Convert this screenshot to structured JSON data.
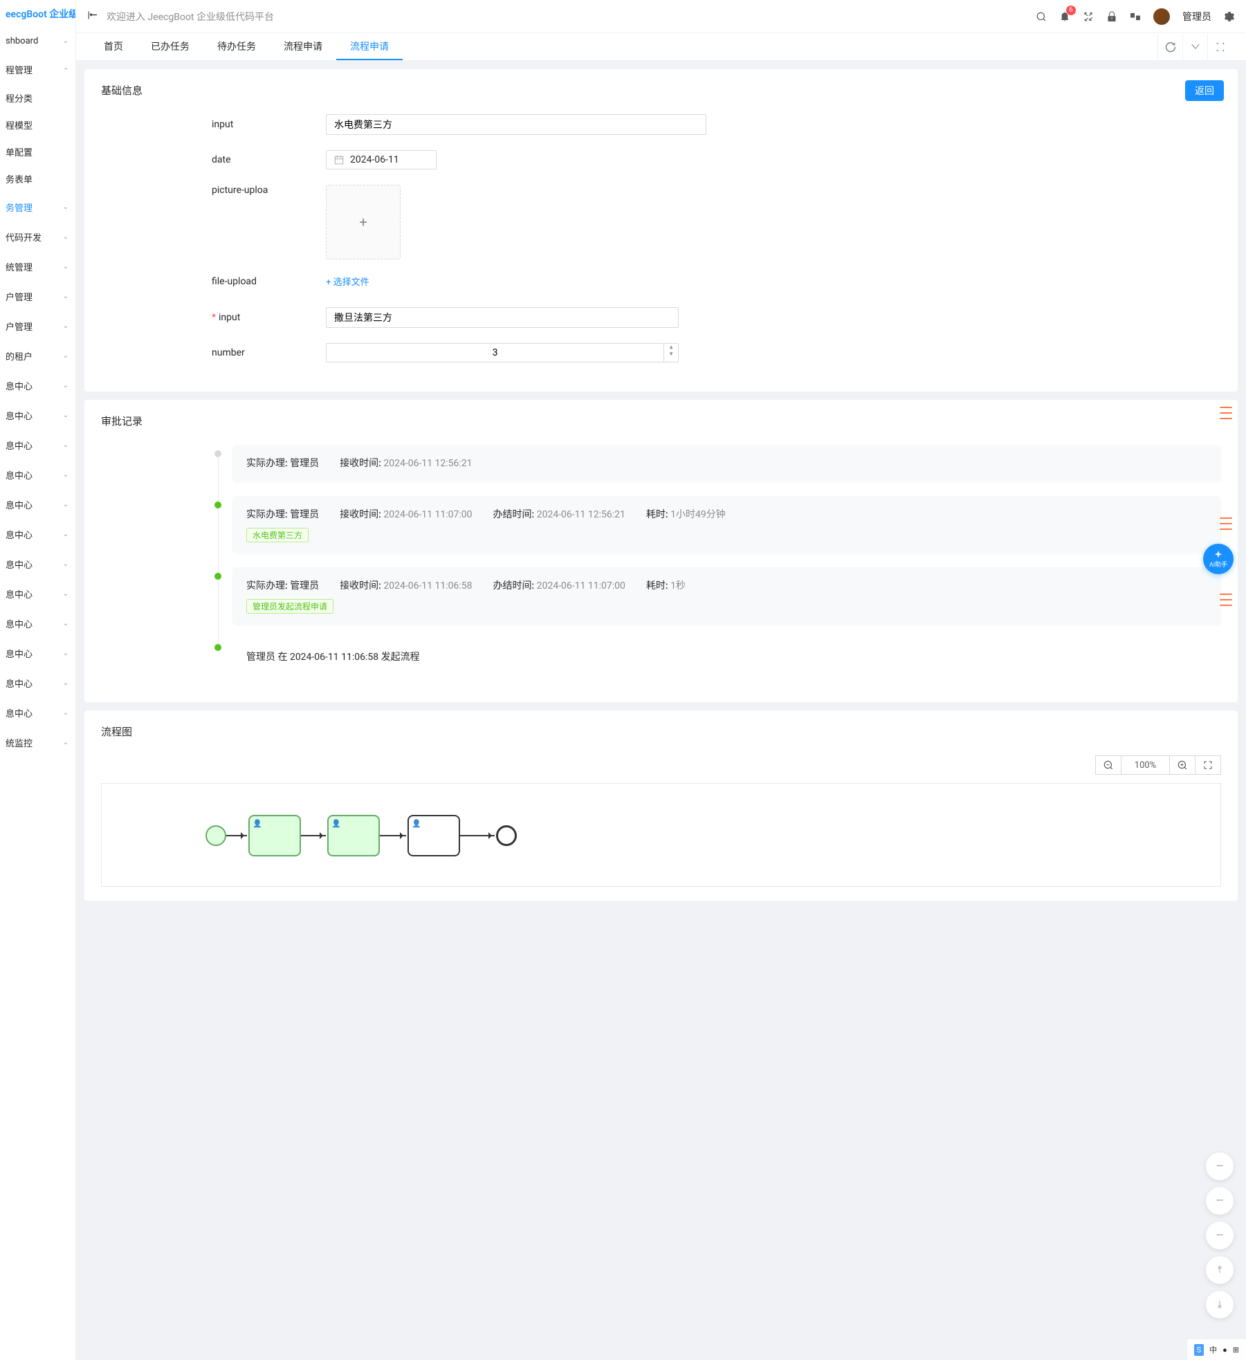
{
  "logo": "eecgBoot 企业级...",
  "welcome": "欢迎进入 JeecgBoot 企业级低代码平台",
  "notif_count": "6",
  "username": "管理员",
  "sidebar": [
    {
      "label": "shboard",
      "children": false,
      "expanded": false
    },
    {
      "label": "程管理",
      "children": true,
      "expanded": true
    },
    {
      "label": "程分类",
      "sub": true
    },
    {
      "label": "程模型",
      "sub": true
    },
    {
      "label": "单配置",
      "sub": true
    },
    {
      "label": "务表单",
      "sub": true
    },
    {
      "label": "务管理",
      "sub": true,
      "active": true,
      "children": true
    },
    {
      "label": "代码开发",
      "children": true
    },
    {
      "label": "统管理",
      "children": true
    },
    {
      "label": "户管理",
      "children": true
    },
    {
      "label": "户管理",
      "children": true
    },
    {
      "label": "的租户",
      "children": true
    },
    {
      "label": "息中心",
      "children": true
    },
    {
      "label": "息中心",
      "children": true
    },
    {
      "label": "息中心",
      "children": true
    },
    {
      "label": "息中心",
      "children": true
    },
    {
      "label": "息中心",
      "children": true
    },
    {
      "label": "息中心",
      "children": true
    },
    {
      "label": "息中心",
      "children": true
    },
    {
      "label": "息中心",
      "children": true
    },
    {
      "label": "息中心",
      "children": true
    },
    {
      "label": "息中心",
      "children": true
    },
    {
      "label": "息中心",
      "children": true
    },
    {
      "label": "息中心",
      "children": true
    },
    {
      "label": "统监控",
      "children": true
    }
  ],
  "tabs": [
    "首页",
    "已办任务",
    "待办任务",
    "流程申请",
    "流程申请"
  ],
  "active_tab": 4,
  "card1": {
    "title": "基础信息",
    "back": "返回",
    "f_input": {
      "label": "input",
      "value": "水电费第三方"
    },
    "f_date": {
      "label": "date",
      "value": "2024-06-11"
    },
    "f_pic": {
      "label": "picture-uploa"
    },
    "f_file": {
      "label": "file-upload",
      "link": "选择文件"
    },
    "f_input2": {
      "label": "input",
      "value": "撒旦法第三方",
      "required": true
    },
    "f_number": {
      "label": "number",
      "value": "3"
    }
  },
  "card2": {
    "title": "审批记录",
    "items": [
      {
        "dot": "gray",
        "handler_lbl": "实际办理:",
        "handler": "管理员",
        "recv_lbl": "接收时间:",
        "recv": "2024-06-11 12:56:21"
      },
      {
        "dot": "green",
        "handler_lbl": "实际办理:",
        "handler": "管理员",
        "recv_lbl": "接收时间:",
        "recv": "2024-06-11 11:07:00",
        "done_lbl": "办结时间:",
        "done": "2024-06-11 12:56:21",
        "dur_lbl": "耗时:",
        "dur": "1小时49分钟",
        "tag": "水电费第三方"
      },
      {
        "dot": "green",
        "handler_lbl": "实际办理:",
        "handler": "管理员",
        "recv_lbl": "接收时间:",
        "recv": "2024-06-11 11:06:58",
        "done_lbl": "办结时间:",
        "done": "2024-06-11 11:07:00",
        "dur_lbl": "耗时:",
        "dur": "1秒",
        "tag": "管理员发起流程申请"
      },
      {
        "dot": "green",
        "plain": "管理员 在 2024-06-11 11:06:58 发起流程"
      }
    ]
  },
  "card3": {
    "title": "流程图",
    "zoom": "100%"
  },
  "ai": "AI助手",
  "taskbar": {
    "ime": "中"
  }
}
